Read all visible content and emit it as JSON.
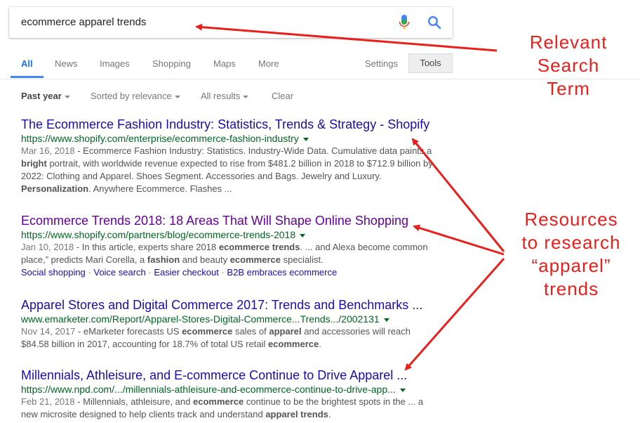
{
  "search": {
    "query": "ecommerce apparel trends"
  },
  "tabs": [
    "All",
    "News",
    "Images",
    "Shopping",
    "Maps",
    "More"
  ],
  "settings_label": "Settings",
  "tools_label": "Tools",
  "filters": {
    "time": "Past year",
    "sort": "Sorted by relevance",
    "results": "All results",
    "clear": "Clear"
  },
  "results": [
    {
      "title": "The Ecommerce Fashion Industry: Statistics, Trends & Strategy - Shopify",
      "url": "https://www.shopify.com/enterprise/ecommerce-fashion-industry",
      "date": "Mar 16, 2018",
      "snippet": [
        {
          "t": " - Ecommerce Fashion Industry: Statistics. Industry-Wide Data. Cumulative data paints a "
        },
        {
          "t": "bright",
          "b": true
        },
        {
          "t": " portrait, with worldwide revenue expected to rise from $481.2 billion in 2018 to $712.9 billion by 2022: Clothing and Apparel. Shoes Segment. Accessories and Bags. Jewelry and Luxury. "
        },
        {
          "t": "Personalization",
          "b": true
        },
        {
          "t": ". Anywhere Ecommerce. Flashes ..."
        }
      ]
    },
    {
      "title": "Ecommerce Trends 2018: 18 Areas That Will Shape Online Shopping",
      "url": "https://www.shopify.com/partners/blog/ecommerce-trends-2018",
      "date": "Jan 10, 2018",
      "snippet": [
        {
          "t": " - In this article, experts share 2018 "
        },
        {
          "t": "ecommerce trends",
          "b": true
        },
        {
          "t": ". ... and Alexa become common place,” predicts Mari Corella, a "
        },
        {
          "t": "fashion",
          "b": true
        },
        {
          "t": " and beauty "
        },
        {
          "t": "ecommerce",
          "b": true
        },
        {
          "t": " specialist."
        }
      ],
      "sitelinks": [
        "Social shopping",
        "Voice search",
        "Easier checkout",
        "B2B embraces ecommerce"
      ]
    },
    {
      "title": "Apparel Stores and Digital Commerce 2017: Trends and Benchmarks ...",
      "url": "www.emarketer.com/Report/Apparel-Stores-Digital-Commerce...Trends.../2002131",
      "date": "Nov 14, 2017",
      "snippet": [
        {
          "t": " - eMarketer forecasts US "
        },
        {
          "t": "ecommerce",
          "b": true
        },
        {
          "t": " sales of "
        },
        {
          "t": "apparel",
          "b": true
        },
        {
          "t": " and accessories will reach $84.58 billion in 2017, accounting for 18.7% of total US retail "
        },
        {
          "t": "ecommerce",
          "b": true
        },
        {
          "t": "."
        }
      ]
    },
    {
      "title": "Millennials, Athleisure, and E-commerce Continue to Drive Apparel ...",
      "url": "https://www.npd.com/.../millennials-athleisure-and-ecommerce-continue-to-drive-app...",
      "date": "Feb 21, 2018",
      "snippet": [
        {
          "t": " - Millennials, athleisure, and "
        },
        {
          "t": "ecommerce",
          "b": true
        },
        {
          "t": " continue to be the brightest spots in the ... a new microsite designed to help clients track and understand "
        },
        {
          "t": "apparel trends",
          "b": true
        },
        {
          "t": "."
        }
      ]
    }
  ],
  "annotations": {
    "search_term": [
      "Relevant",
      "Search",
      "Term"
    ],
    "resources": [
      "Resources",
      "to research",
      "“apparel”",
      "trends"
    ]
  },
  "colors": {
    "annotation": "#e8201c",
    "link": "#1a0dab",
    "visited": "#660099",
    "url": "#006621",
    "accent": "#4285f4"
  }
}
